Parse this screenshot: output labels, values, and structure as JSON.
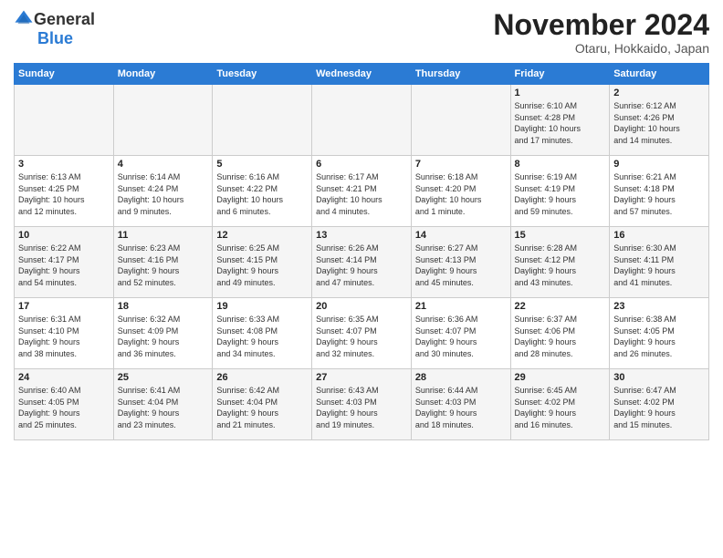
{
  "header": {
    "logo_general": "General",
    "logo_blue": "Blue",
    "month_title": "November 2024",
    "location": "Otaru, Hokkaido, Japan"
  },
  "weekdays": [
    "Sunday",
    "Monday",
    "Tuesday",
    "Wednesday",
    "Thursday",
    "Friday",
    "Saturday"
  ],
  "weeks": [
    [
      {
        "day": "",
        "info": ""
      },
      {
        "day": "",
        "info": ""
      },
      {
        "day": "",
        "info": ""
      },
      {
        "day": "",
        "info": ""
      },
      {
        "day": "",
        "info": ""
      },
      {
        "day": "1",
        "info": "Sunrise: 6:10 AM\nSunset: 4:28 PM\nDaylight: 10 hours\nand 17 minutes."
      },
      {
        "day": "2",
        "info": "Sunrise: 6:12 AM\nSunset: 4:26 PM\nDaylight: 10 hours\nand 14 minutes."
      }
    ],
    [
      {
        "day": "3",
        "info": "Sunrise: 6:13 AM\nSunset: 4:25 PM\nDaylight: 10 hours\nand 12 minutes."
      },
      {
        "day": "4",
        "info": "Sunrise: 6:14 AM\nSunset: 4:24 PM\nDaylight: 10 hours\nand 9 minutes."
      },
      {
        "day": "5",
        "info": "Sunrise: 6:16 AM\nSunset: 4:22 PM\nDaylight: 10 hours\nand 6 minutes."
      },
      {
        "day": "6",
        "info": "Sunrise: 6:17 AM\nSunset: 4:21 PM\nDaylight: 10 hours\nand 4 minutes."
      },
      {
        "day": "7",
        "info": "Sunrise: 6:18 AM\nSunset: 4:20 PM\nDaylight: 10 hours\nand 1 minute."
      },
      {
        "day": "8",
        "info": "Sunrise: 6:19 AM\nSunset: 4:19 PM\nDaylight: 9 hours\nand 59 minutes."
      },
      {
        "day": "9",
        "info": "Sunrise: 6:21 AM\nSunset: 4:18 PM\nDaylight: 9 hours\nand 57 minutes."
      }
    ],
    [
      {
        "day": "10",
        "info": "Sunrise: 6:22 AM\nSunset: 4:17 PM\nDaylight: 9 hours\nand 54 minutes."
      },
      {
        "day": "11",
        "info": "Sunrise: 6:23 AM\nSunset: 4:16 PM\nDaylight: 9 hours\nand 52 minutes."
      },
      {
        "day": "12",
        "info": "Sunrise: 6:25 AM\nSunset: 4:15 PM\nDaylight: 9 hours\nand 49 minutes."
      },
      {
        "day": "13",
        "info": "Sunrise: 6:26 AM\nSunset: 4:14 PM\nDaylight: 9 hours\nand 47 minutes."
      },
      {
        "day": "14",
        "info": "Sunrise: 6:27 AM\nSunset: 4:13 PM\nDaylight: 9 hours\nand 45 minutes."
      },
      {
        "day": "15",
        "info": "Sunrise: 6:28 AM\nSunset: 4:12 PM\nDaylight: 9 hours\nand 43 minutes."
      },
      {
        "day": "16",
        "info": "Sunrise: 6:30 AM\nSunset: 4:11 PM\nDaylight: 9 hours\nand 41 minutes."
      }
    ],
    [
      {
        "day": "17",
        "info": "Sunrise: 6:31 AM\nSunset: 4:10 PM\nDaylight: 9 hours\nand 38 minutes."
      },
      {
        "day": "18",
        "info": "Sunrise: 6:32 AM\nSunset: 4:09 PM\nDaylight: 9 hours\nand 36 minutes."
      },
      {
        "day": "19",
        "info": "Sunrise: 6:33 AM\nSunset: 4:08 PM\nDaylight: 9 hours\nand 34 minutes."
      },
      {
        "day": "20",
        "info": "Sunrise: 6:35 AM\nSunset: 4:07 PM\nDaylight: 9 hours\nand 32 minutes."
      },
      {
        "day": "21",
        "info": "Sunrise: 6:36 AM\nSunset: 4:07 PM\nDaylight: 9 hours\nand 30 minutes."
      },
      {
        "day": "22",
        "info": "Sunrise: 6:37 AM\nSunset: 4:06 PM\nDaylight: 9 hours\nand 28 minutes."
      },
      {
        "day": "23",
        "info": "Sunrise: 6:38 AM\nSunset: 4:05 PM\nDaylight: 9 hours\nand 26 minutes."
      }
    ],
    [
      {
        "day": "24",
        "info": "Sunrise: 6:40 AM\nSunset: 4:05 PM\nDaylight: 9 hours\nand 25 minutes."
      },
      {
        "day": "25",
        "info": "Sunrise: 6:41 AM\nSunset: 4:04 PM\nDaylight: 9 hours\nand 23 minutes."
      },
      {
        "day": "26",
        "info": "Sunrise: 6:42 AM\nSunset: 4:04 PM\nDaylight: 9 hours\nand 21 minutes."
      },
      {
        "day": "27",
        "info": "Sunrise: 6:43 AM\nSunset: 4:03 PM\nDaylight: 9 hours\nand 19 minutes."
      },
      {
        "day": "28",
        "info": "Sunrise: 6:44 AM\nSunset: 4:03 PM\nDaylight: 9 hours\nand 18 minutes."
      },
      {
        "day": "29",
        "info": "Sunrise: 6:45 AM\nSunset: 4:02 PM\nDaylight: 9 hours\nand 16 minutes."
      },
      {
        "day": "30",
        "info": "Sunrise: 6:47 AM\nSunset: 4:02 PM\nDaylight: 9 hours\nand 15 minutes."
      }
    ]
  ]
}
